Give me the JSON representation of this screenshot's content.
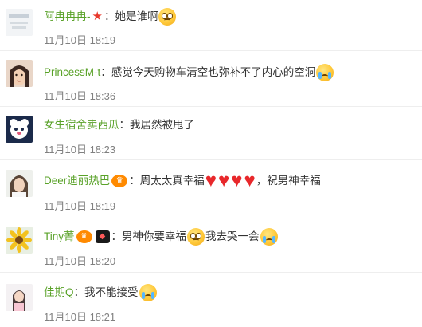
{
  "separator": "：",
  "comments": [
    {
      "username": "阿冉冉冉-",
      "text_parts": [
        "她是谁啊"
      ],
      "time": "11月10日 18:19",
      "avatar": "avatar-image",
      "accent": "#5aa229"
    },
    {
      "username": "PrincessM-t",
      "text_parts": [
        "感觉今天购物车清空也弥补不了内心的空洞"
      ],
      "time": "11月10日 18:36",
      "avatar": "avatar-image"
    },
    {
      "username": "女生宿舍卖西瓜",
      "text_parts": [
        "我居然被甩了"
      ],
      "time": "11月10日 18:23",
      "avatar": "avatar-image"
    },
    {
      "username": "Deer迪丽热巴",
      "text_parts": [
        "周太太真幸福",
        "，祝男神幸福"
      ],
      "time": "11月10日 18:19",
      "avatar": "avatar-image"
    },
    {
      "username": "Tiny菁",
      "text_parts": [
        "男神你要幸福",
        "我去哭一会"
      ],
      "time": "11月10日 18:20",
      "avatar": "avatar-image"
    },
    {
      "username": "佳期Q",
      "text_parts": [
        "我不能接受"
      ],
      "time": "11月10日 18:21",
      "avatar": "avatar-image"
    }
  ]
}
